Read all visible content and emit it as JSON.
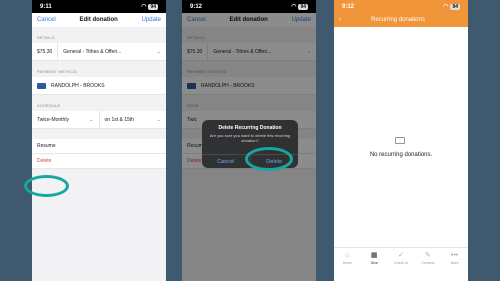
{
  "screen1": {
    "time": "9:11",
    "battery": "94",
    "cancel": "Cancel",
    "title": "Edit donation",
    "update": "Update",
    "details_label": "DETAILS",
    "amount": "$75.30",
    "fund": "General - Tithes & Offeri...",
    "payment_label": "PAYMENT METHOD",
    "payment_method": "RANDOLPH - BROOKS",
    "schedule_label": "SCHEDULE",
    "frequency": "Twice-Monthly",
    "days": "on 1st & 15th",
    "resume": "Resume",
    "delete": "Delete"
  },
  "screen2": {
    "time": "9:12",
    "battery": "94",
    "cancel": "Cancel",
    "title": "Edit donation",
    "update": "Update",
    "details_label": "DETAILS",
    "amount": "$75.30",
    "fund": "General - Tithes & Offeri...",
    "payment_label": "PAYMENT METHOD",
    "payment_method": "RANDOLPH - BROOKS",
    "schedule_label": "SCHE",
    "frequency": "Twic",
    "resume": "Resume",
    "delete": "Delete",
    "alert": {
      "title": "Delete Recurring Donation",
      "message": "Are you sure you want to delete this recurring donation?",
      "cancel": "Cancel",
      "delete": "Delete"
    }
  },
  "screen3": {
    "time": "9:12",
    "battery": "94",
    "title": "Recurring donations",
    "empty_text": "No recurring donations.",
    "tabs": [
      {
        "label": "Home",
        "icon": "home-icon",
        "glyph": "⌂"
      },
      {
        "label": "Give",
        "icon": "give-icon",
        "glyph": "▦"
      },
      {
        "label": "Check In",
        "icon": "check-icon",
        "glyph": "✓"
      },
      {
        "label": "Connect",
        "icon": "edit-icon",
        "glyph": "✎"
      },
      {
        "label": "More",
        "icon": "more-icon",
        "glyph": "•••"
      }
    ]
  },
  "colors": {
    "accent": "#2a7be4",
    "highlight": "#15a8a0",
    "orange": "#f1953a",
    "danger": "#e0453b"
  }
}
